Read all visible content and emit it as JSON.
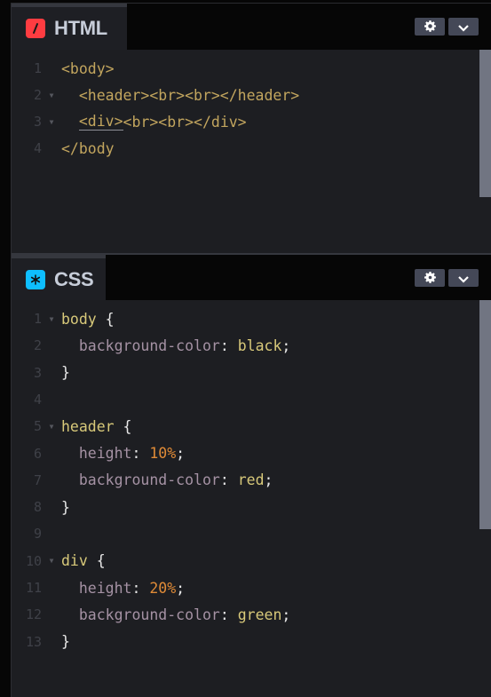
{
  "html_pane": {
    "tab_label": "HTML",
    "tab_icon": "slash-icon",
    "icon_color": "#ff3c41",
    "settings_button": "gear-icon",
    "collapse_button": "chevron-down-icon",
    "lines": [
      {
        "num": "1",
        "fold": "",
        "text": "<body>"
      },
      {
        "num": "2",
        "fold": "▼",
        "text": "  <header><br><br></header>"
      },
      {
        "num": "3",
        "fold": "▼",
        "text_underlined": "<div>",
        "text": "<br><br></div>"
      },
      {
        "num": "4",
        "fold": "",
        "text": "</body"
      }
    ]
  },
  "css_pane": {
    "tab_label": "CSS",
    "tab_icon": "asterisk-icon",
    "icon_color": "#0ebeff",
    "settings_button": "gear-icon",
    "collapse_button": "chevron-down-icon",
    "lines": [
      {
        "num": "1",
        "fold": "▼",
        "selector": "body",
        "brace": " {"
      },
      {
        "num": "2",
        "fold": "",
        "prop": "background-color",
        "value": "black",
        "value_type": "keyword"
      },
      {
        "num": "3",
        "fold": "",
        "close": "}"
      },
      {
        "num": "4",
        "fold": ""
      },
      {
        "num": "5",
        "fold": "▼",
        "selector": "header",
        "brace": " {"
      },
      {
        "num": "6",
        "fold": "",
        "prop": "height",
        "value": "10%",
        "value_type": "number"
      },
      {
        "num": "7",
        "fold": "",
        "prop": "background-color",
        "value": "red",
        "value_type": "keyword"
      },
      {
        "num": "8",
        "fold": "",
        "close": "}"
      },
      {
        "num": "9",
        "fold": ""
      },
      {
        "num": "10",
        "fold": "▼",
        "selector": "div",
        "brace": " {"
      },
      {
        "num": "11",
        "fold": "",
        "prop": "height",
        "value": "20%",
        "value_type": "number"
      },
      {
        "num": "12",
        "fold": "",
        "prop": "background-color",
        "value": "green",
        "value_type": "keyword"
      },
      {
        "num": "13",
        "fold": "",
        "close": "}"
      }
    ]
  },
  "symbols": {
    "colon": ": ",
    "semicolon": ";",
    "indent": "  "
  }
}
